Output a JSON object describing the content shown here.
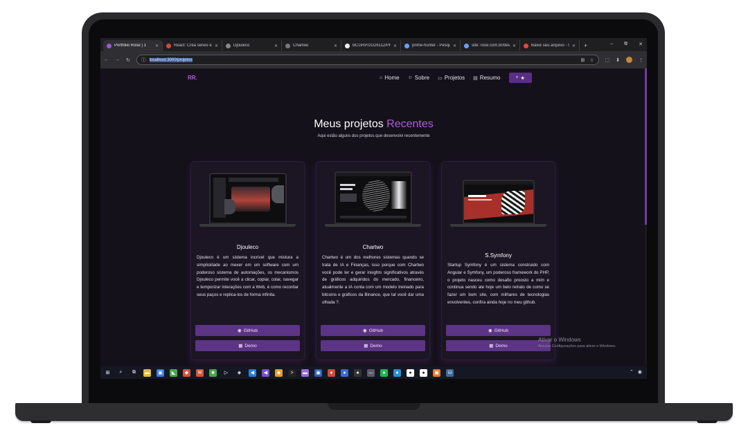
{
  "browser": {
    "tabs": [
      {
        "title": "Portfólio Rose | 1",
        "active": true,
        "favicon_color": "#9b59d0"
      },
      {
        "title": "React: Crea series e mais...",
        "favicon_color": "#d04a3a"
      },
      {
        "title": "Djouleco",
        "favicon_color": "#888888"
      },
      {
        "title": "Chartwo",
        "favicon_color": "#777777"
      },
      {
        "title": "BCGRP/2G26112/PHC",
        "favicon_color": "#eeeeee"
      },
      {
        "title": "prime-hunter - Pesquisa",
        "favicon_color": "#6aa0f0"
      },
      {
        "title": "site: rose.com.br/dev",
        "favicon_color": "#6aa0f0"
      },
      {
        "title": "Baixe seu arquivo - Sm",
        "favicon_color": "#e04a3a"
      }
    ],
    "new_tab": "+",
    "window_controls": [
      "–",
      "⧉",
      "✕"
    ],
    "nav_icons": [
      "←",
      "→",
      "↻"
    ],
    "url": "localhost:3000/projetos",
    "omni_icons": [
      "⊞",
      "☆"
    ],
    "extension_icons": [
      "⬚",
      "⬇"
    ]
  },
  "site": {
    "logo": "RR.",
    "nav": [
      {
        "icon": "⌂",
        "label": "Home"
      },
      {
        "icon": "☺",
        "label": "Sobre"
      },
      {
        "icon": "▭",
        "label": "Projetos"
      },
      {
        "icon": "▤",
        "label": "Resumo"
      }
    ],
    "nav_button": "★",
    "heading_prefix": "Meus projetos",
    "heading_accent": "Recentes",
    "subheading": "Aqui estão alguns dos projetos que desenvolvi recentemente",
    "projects": [
      {
        "title": "Djouleco",
        "description": "Djouleco é um sistema incrível que mistura a simplicidade ao mexer em um software com um poderoso sistema de automações, os mecanismos Djouleco permite você a clicar, copiar, colar, navegar e temporizar interações com a Web, é como recordar seus paços e replica-los de forma infinita.",
        "github_label": "GitHub",
        "demo_label": "Demo"
      },
      {
        "title": "Chartwo",
        "description": "Chartwo é um dos melhores sistemas quando se trata de IA e Finanças, isso porque com Chartwo você pode ler e gerar insights significativos através de gráficos adquiridos do mercado, financeiro, atualmente a IA conta com um modelo treinado para bitcoins e gráficos da Binance, que tal você dar uma olhada ?.",
        "github_label": "GitHub",
        "demo_label": "Demo"
      },
      {
        "title": "S.Symfony",
        "description": "Startup Symfony é um sistema construido com Angular e Symfony, um poderoso framework do PHP, o projeto nasceu como desafio proosto a mim e continua sendo ate hoje um belo retrato de como se fazer um bom site, com milhares de tecnologias envolventes, confira ainda hoje no meu github.",
        "github_label": "GitHub",
        "demo_label": "Demo"
      }
    ],
    "github_icon": "◉",
    "demo_icon": "▦"
  },
  "watermark": {
    "line1": "Ativar o Windows",
    "line2": "Acesse Configurações para ativar o Windows."
  },
  "taskbar": {
    "icons": [
      {
        "name": "windows-start",
        "glyph": "⊞",
        "color": "#151823"
      },
      {
        "name": "search",
        "glyph": "⌕",
        "color": "#151823"
      },
      {
        "name": "task-view",
        "glyph": "⧉",
        "color": "#151823"
      },
      {
        "name": "file-explorer",
        "glyph": "▬",
        "color": "#e8b93a"
      },
      {
        "name": "store",
        "glyph": "▣",
        "color": "#3a7be0"
      },
      {
        "name": "nvidia",
        "glyph": "◣",
        "color": "#4aa84a"
      },
      {
        "name": "app-red",
        "glyph": "◆",
        "color": "#d0553a"
      },
      {
        "name": "mail",
        "glyph": "✉",
        "color": "#d0553a"
      },
      {
        "name": "cube",
        "glyph": "■",
        "color": "#4aa84a"
      },
      {
        "name": "triangle",
        "glyph": "▷",
        "color": "#151823"
      },
      {
        "name": "unity",
        "glyph": "◈",
        "color": "#151823"
      },
      {
        "name": "vscode",
        "glyph": "◀",
        "color": "#2b7fd6"
      },
      {
        "name": "visual-studio",
        "glyph": "◀",
        "color": "#7a4fd0"
      },
      {
        "name": "layers",
        "glyph": "◆",
        "color": "#e0a030"
      },
      {
        "name": "terminal",
        "glyph": ">",
        "color": "#222222"
      },
      {
        "name": "folder",
        "glyph": "▬",
        "color": "#9a6ad8"
      },
      {
        "name": "vs-code-blue",
        "glyph": "▣",
        "color": "#2e5fb8"
      },
      {
        "name": "chrome",
        "glyph": "●",
        "color": "#d04a3a"
      },
      {
        "name": "edge",
        "glyph": "●",
        "color": "#3a6ad8"
      },
      {
        "name": "github",
        "glyph": "●",
        "color": "#333333"
      },
      {
        "name": "dash",
        "glyph": "—",
        "color": "#5a5a66"
      },
      {
        "name": "spotify",
        "glyph": "●",
        "color": "#1db954"
      },
      {
        "name": "bluebird",
        "glyph": "●",
        "color": "#2b8fd6"
      },
      {
        "name": "steam",
        "glyph": "●",
        "color": "#ffffff"
      },
      {
        "name": "circle-white",
        "glyph": "●",
        "color": "#ffffff"
      },
      {
        "name": "orange-app",
        "glyph": "▣",
        "color": "#e07a30"
      },
      {
        "name": "postgres",
        "glyph": "⛁",
        "color": "#3a6a9a"
      }
    ],
    "tray": [
      "⌃",
      "◉"
    ]
  }
}
